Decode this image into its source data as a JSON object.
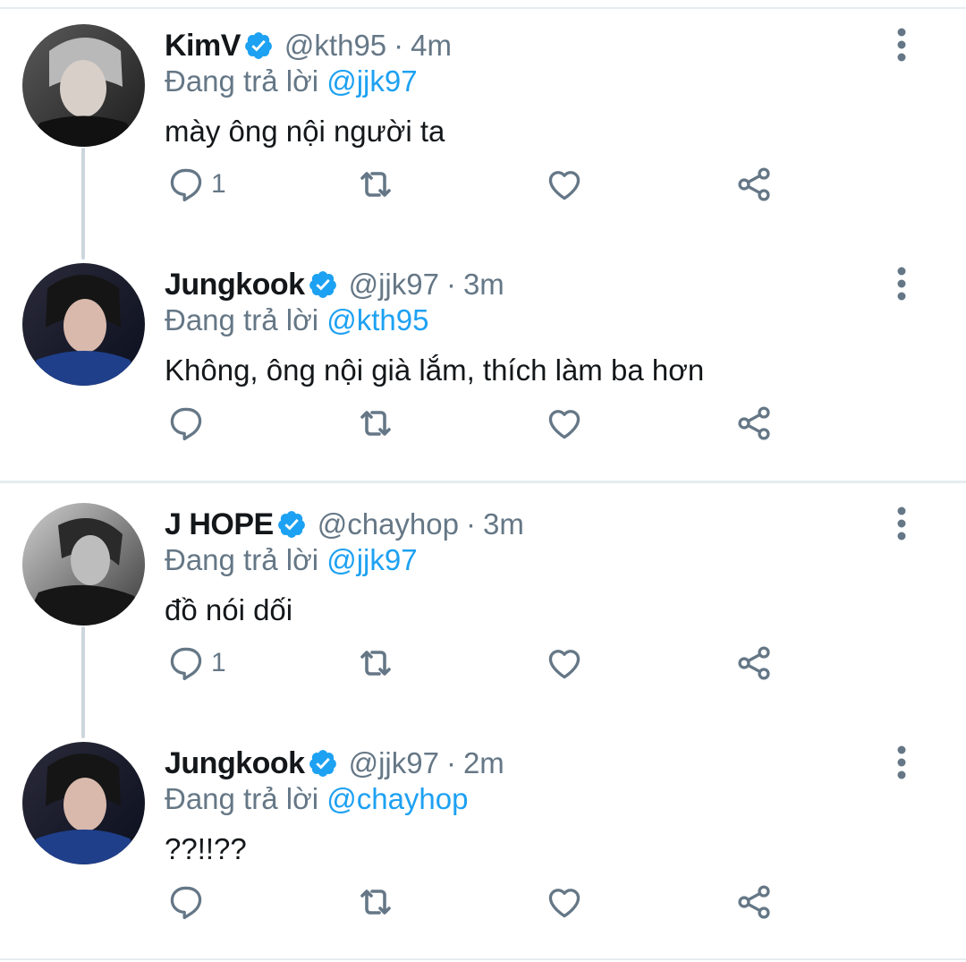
{
  "tweets": [
    {
      "name": "KimV",
      "handle": "@kth95",
      "dot": "·",
      "time": "4m",
      "replying_prefix": "Đang trả lời",
      "replying_to": "@jjk97",
      "text": "mày ông nội người ta",
      "reply_count": "1"
    },
    {
      "name": "Jungkook",
      "handle": "@jjk97",
      "dot": "·",
      "time": "3m",
      "replying_prefix": "Đang trả lời",
      "replying_to": "@kth95",
      "text": "Không, ông nội già lắm, thích làm ba hơn",
      "reply_count": ""
    },
    {
      "name": "J HOPE",
      "handle": "@chayhop",
      "dot": "·",
      "time": "3m",
      "replying_prefix": "Đang trả lời",
      "replying_to": "@jjk97",
      "text": "đồ nói dối",
      "reply_count": "1"
    },
    {
      "name": "Jungkook",
      "handle": "@jjk97",
      "dot": "·",
      "time": "2m",
      "replying_prefix": "Đang trả lời",
      "replying_to": "@chayhop",
      "text": "??!!??",
      "reply_count": ""
    }
  ],
  "colors": {
    "accent": "#1da1f2",
    "secondary_text": "#657786",
    "icon": "#657786",
    "border": "#e6ecf0"
  },
  "icons": [
    "verified-badge-icon",
    "more-vertical-icon",
    "reply-icon",
    "retweet-icon",
    "like-icon",
    "share-icon"
  ]
}
